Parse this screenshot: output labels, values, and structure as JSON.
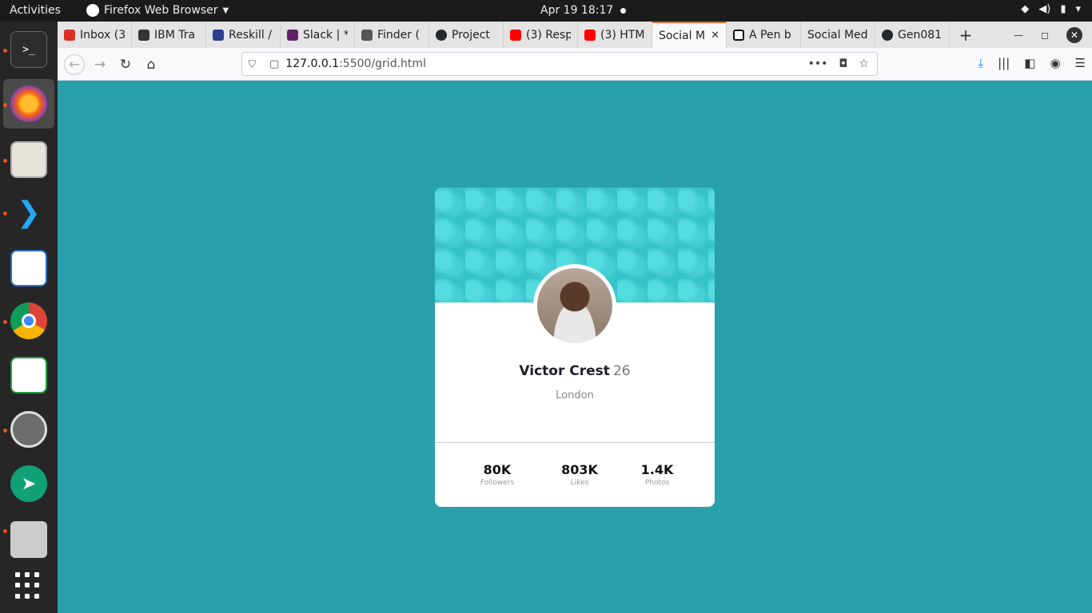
{
  "topbar": {
    "activities": "Activities",
    "app_name": "Firefox Web Browser",
    "clock": "Apr 19  18:17"
  },
  "tabs": [
    {
      "label": "Inbox (3",
      "fav_color": "#d93025"
    },
    {
      "label": "IBM Tra",
      "fav_color": "#333333"
    },
    {
      "label": "Reskill /",
      "fav_color": "#2b3e8c"
    },
    {
      "label": "Slack | *",
      "fav_color": "#611f69"
    },
    {
      "label": "Finder (",
      "fav_color": "#555555"
    },
    {
      "label": "Project",
      "fav_color": "#24292e"
    },
    {
      "label": "(3) Resp",
      "fav_color": "#ff0000"
    },
    {
      "label": "(3) HTM",
      "fav_color": "#ff0000"
    },
    {
      "label": "Social M",
      "fav_color": "#ffffff"
    },
    {
      "label": "A Pen b",
      "fav_color": "#111111"
    },
    {
      "label": "Social Med",
      "fav_color": "#e4e4e4"
    },
    {
      "label": "Gen081",
      "fav_color": "#24292e"
    }
  ],
  "url": {
    "host": "127.0.0.1",
    "rest": ":5500/grid.html"
  },
  "profile": {
    "name": "Victor Crest",
    "age": "26",
    "city": "London"
  },
  "stats": [
    {
      "value": "80K",
      "label": "Followers"
    },
    {
      "value": "803K",
      "label": "Likes"
    },
    {
      "value": "1.4K",
      "label": "Photos"
    }
  ],
  "colors": {
    "page_bg": "#2aa0aa",
    "banner": "#35c3c8",
    "tab_accent": "#e0703b"
  }
}
